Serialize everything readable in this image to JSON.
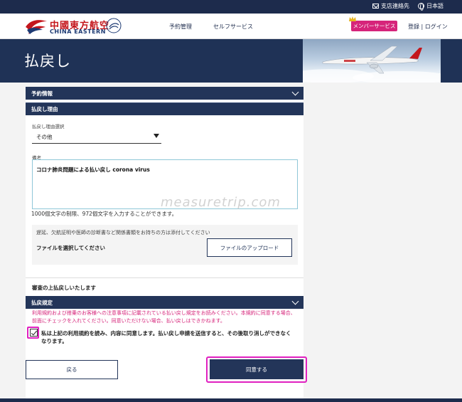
{
  "utility": {
    "contact": "支店連絡先",
    "language": "日本語"
  },
  "header": {
    "logo_cn": "中國東方航空",
    "logo_en": "CHINA EASTERN",
    "nav_reserve": "予約管理",
    "nav_self": "セルフサービス",
    "member_button": "メンバーサービス",
    "login_links": "登録 | ログイン"
  },
  "banner": {
    "title": "払戻し"
  },
  "sections": {
    "reservation_info": "予約情報",
    "refund_reason": "払戻し理由",
    "refund_rules": "払戻規定"
  },
  "form": {
    "reason_select_label": "払戻し理由選択",
    "reason_selected": "その他",
    "remarks_label": "備考",
    "remarks_value": "コロナ肺炎問題による払い戻し  corona virus",
    "char_count": "1000個文字の制限、972個文字を入力することができます。",
    "watermark": "measuretrip.com",
    "upload_note": "遅延、欠航証明や医師の診断書など関係書類をお持ちの方は添付してください",
    "file_label": "ファイルを選択してください",
    "upload_button": "ファイルのアップロード",
    "review_text": "審査の上払戻しいたします"
  },
  "rules": {
    "notice": "利用規約および搭乗のお客様への注意事項に記載されている払い戻し規定をお読みください。本規約に同意する場合、前面にチェックを入れてください。同意いただけない場合、払い戻しはできかねます。",
    "agree_checked": true,
    "agree_text": "私は上記の利用規約を読み、内容に同意します。払い戻し申請を送信すると、その後取り消しができなくなります。"
  },
  "buttons": {
    "back": "戻る",
    "agree": "同意する"
  },
  "colors": {
    "navy": "#233559",
    "accent_pink": "#d6247a",
    "highlight_magenta": "#e020c0",
    "brand_red": "#c4161c"
  }
}
